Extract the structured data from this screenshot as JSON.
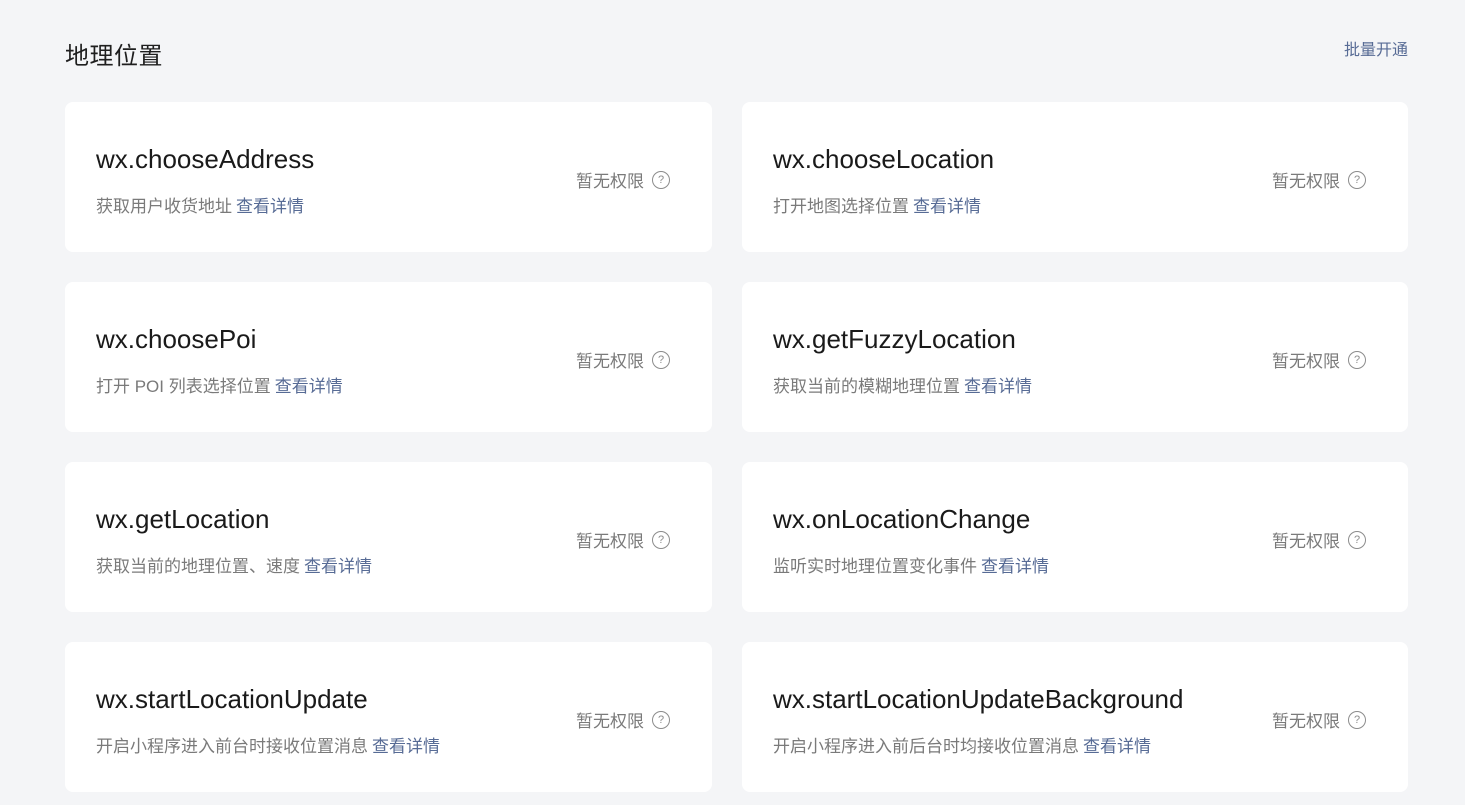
{
  "header": {
    "title": "地理位置",
    "batch_label": "批量开通"
  },
  "cards": [
    {
      "name": "wx.chooseAddress",
      "desc": "获取用户收货地址",
      "link": "查看详情",
      "status": "暂无权限"
    },
    {
      "name": "wx.chooseLocation",
      "desc": "打开地图选择位置",
      "link": "查看详情",
      "status": "暂无权限"
    },
    {
      "name": "wx.choosePoi",
      "desc": "打开 POI 列表选择位置",
      "link": "查看详情",
      "status": "暂无权限"
    },
    {
      "name": "wx.getFuzzyLocation",
      "desc": "获取当前的模糊地理位置",
      "link": "查看详情",
      "status": "暂无权限"
    },
    {
      "name": "wx.getLocation",
      "desc": "获取当前的地理位置、速度",
      "link": "查看详情",
      "status": "暂无权限"
    },
    {
      "name": "wx.onLocationChange",
      "desc": "监听实时地理位置变化事件",
      "link": "查看详情",
      "status": "暂无权限"
    },
    {
      "name": "wx.startLocationUpdate",
      "desc": "开启小程序进入前台时接收位置消息",
      "link": "查看详情",
      "status": "暂无权限"
    },
    {
      "name": "wx.startLocationUpdateBackground",
      "desc": "开启小程序进入前后台时均接收位置消息",
      "link": "查看详情",
      "status": "暂无权限"
    }
  ],
  "icons": {
    "help": "question-circle-icon",
    "help_glyph": "?"
  },
  "colors": {
    "link": "#576b95",
    "background": "#f4f5f7",
    "card": "#ffffff"
  }
}
